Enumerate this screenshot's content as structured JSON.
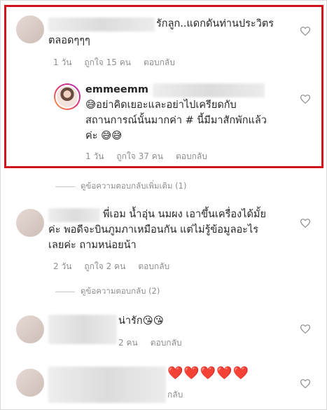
{
  "comments": [
    {
      "text_line1": "รักลูก..แดกดันท่านประวิตร",
      "text_line2": "ตลอดๆๆๆ",
      "time": "1 วัน",
      "likes": "ถูกใจ 15 คน",
      "reply": "ตอบกลับ"
    },
    {
      "username": "emmeemm",
      "text_line1": "😅อย่าคิดเยอะและอย่าไปเครียดกับ",
      "text_line2": "สถานการณ์นั้นมากค่า # นี้มีมาสักพักแล้ว",
      "text_line3": "ค่ะ 😅😅",
      "time": "1 วัน",
      "likes": "ถูกใจ 37 คน",
      "reply": "ตอบกลับ"
    },
    {
      "view_replies": "ดูข้อความตอบกลับเพิ่มเติม (1)"
    },
    {
      "text_line1": "พี่เอม น้ำอุ่น นมผง เอาขึ้นเครื่องได้มั้ย",
      "text_line2": "ค่ะ พอดีจะบินภูมภาเหมือนกัน แต่ไม่รู้ข้อมูลอะไร",
      "text_line3": "เลยค่ะ ถามหน่อยน้า",
      "time": "2 วัน",
      "likes": "ถูกใจ 2 คน",
      "reply": "ตอบกลับ",
      "view_replies": "ดูข้อความตอบกลับ (2)"
    },
    {
      "text_line1": "น่ารัก😘😘",
      "time_partial": "2 คน",
      "reply": "ตอบกลับ"
    },
    {
      "text_line1": "❤️❤️❤️❤️❤️",
      "reply": "กลับ"
    }
  ],
  "icons": {
    "like": "heart-outline-icon"
  },
  "colors": {
    "highlight_border": "#d3131a",
    "meta_text": "#8e8e8e"
  }
}
